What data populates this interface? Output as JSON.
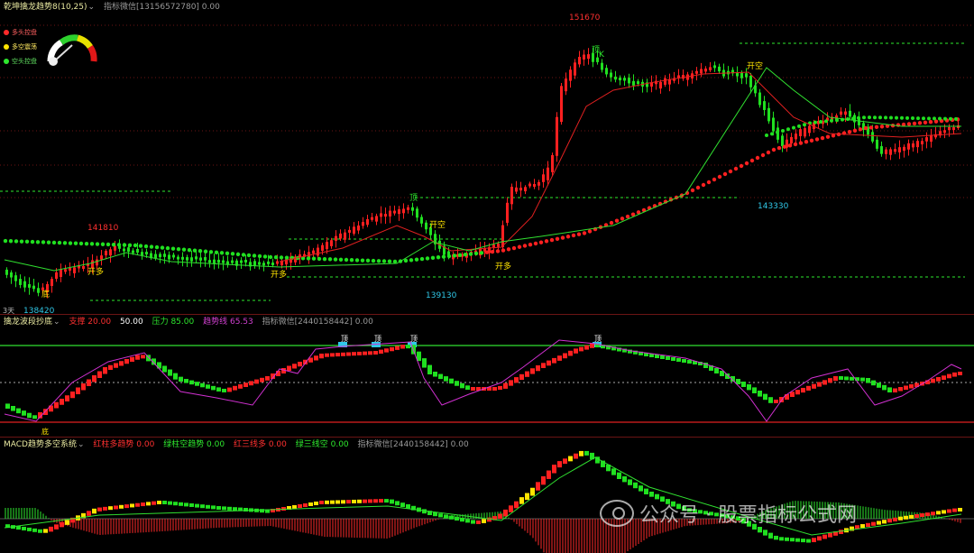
{
  "main": {
    "indicator_name": "乾坤擒龙趋势8(10,25)",
    "indicator_wechat": "指标微信[13156572780] 0.00",
    "legend": [
      {
        "label": "多头控盘",
        "color": "#ff2a2a"
      },
      {
        "label": "多空震荡",
        "color": "#ffe400"
      },
      {
        "label": "空头控盘",
        "color": "#2ee82e"
      }
    ],
    "price_labels": {
      "high_peak": "151670",
      "left_high": "141810",
      "low_start": "138420",
      "mid_low": "139130",
      "right_low": "143330"
    },
    "signals": {
      "open_long_1": "开多",
      "open_long_2": "开多",
      "open_long_3": "开多",
      "open_short_1": "开空",
      "open_short_2": "开空",
      "top": "顶",
      "k": "K",
      "bottom_marker": "底"
    },
    "period": "3天"
  },
  "osc": {
    "indicator_name": "擒龙波段抄底",
    "support_label": "支撑 20.00",
    "mid_value": "50.00",
    "pressure_label": "压力 85.00",
    "trend_label": "趋势线 65.53",
    "indicator_wechat": "指标微信[2440158442] 0.00",
    "top_markers": [
      "顶",
      "顶",
      "顶",
      "顶"
    ],
    "bottom_marker": "底"
  },
  "macd": {
    "indicator_name": "MACD趋势多空系统",
    "red_trend": "红柱多趋势 0.00",
    "green_trend": "绿柱空趋势 0.00",
    "red_line": "红三线多 0.00",
    "green_line": "绿三线空 0.00",
    "indicator_wechat": "指标微信[2440158442] 0.00"
  },
  "watermark": "公众号 · 股票指标公式网",
  "colors": {
    "up": "#ff2020",
    "down": "#20e020",
    "yellow": "#ffe400",
    "magenta": "#d030d0",
    "cyan": "#30c8e8",
    "grid": "#6b1414"
  }
}
